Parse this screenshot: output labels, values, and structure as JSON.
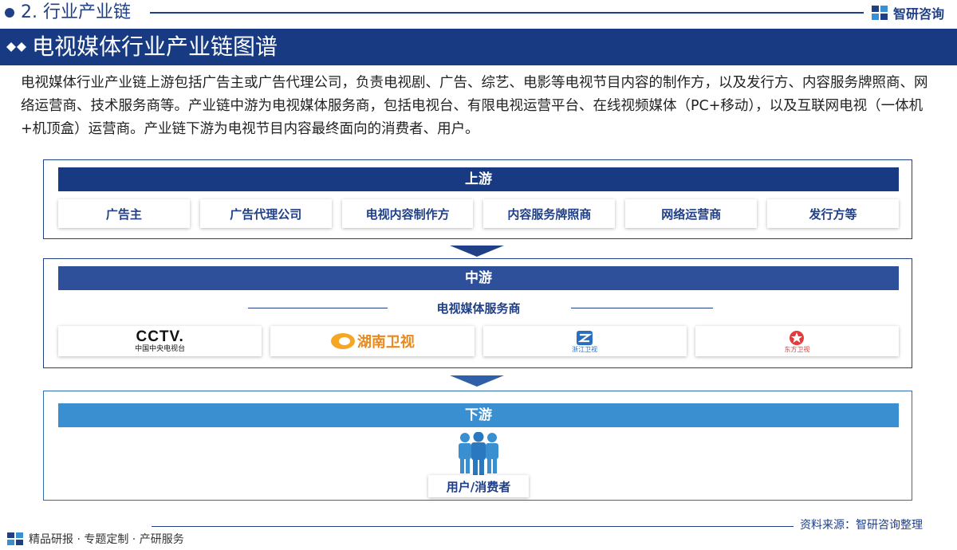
{
  "section": {
    "label": "2. 行业产业链"
  },
  "brand": {
    "name": "智研咨询",
    "color": "#1f3f87"
  },
  "title": "电视媒体行业产业链图谱",
  "intro": "电视媒体行业产业链上游包括广告主或广告代理公司，负责电视剧、广告、综艺、电影等电视节目内容的制作方，以及发行方、内容服务牌照商、网络运营商、技术服务商等。产业链中游为电视媒体服务商，包括电视台、有限电视运营平台、在线视频媒体（PC+移动），以及互联网电视（一体机+机顶盒）运营商。产业链下游为电视节目内容最终面向的消费者、用户。",
  "upstream": {
    "label": "上游",
    "items": [
      "广告主",
      "广告代理公司",
      "电视内容制作方",
      "内容服务牌照商",
      "网络运营商",
      "发行方等"
    ]
  },
  "midstream": {
    "label": "中游",
    "service_label": "电视媒体服务商",
    "logos": [
      {
        "name": "CCTV.",
        "subtitle": "中国中央电视台"
      },
      {
        "name": "湖南卫视"
      },
      {
        "name": "浙江卫视"
      },
      {
        "name": "东方卫视"
      }
    ]
  },
  "downstream": {
    "label": "下游",
    "user_label": "用户/消费者"
  },
  "footer": {
    "source": "资料来源：智研咨询整理",
    "left": "精品研报 · 专题定制 · 产研服务"
  },
  "colors": {
    "navy": "#173a82",
    "mid_band": "#2e4f9a",
    "down_band": "#3a8fd0",
    "people": "#3a8fd0"
  }
}
